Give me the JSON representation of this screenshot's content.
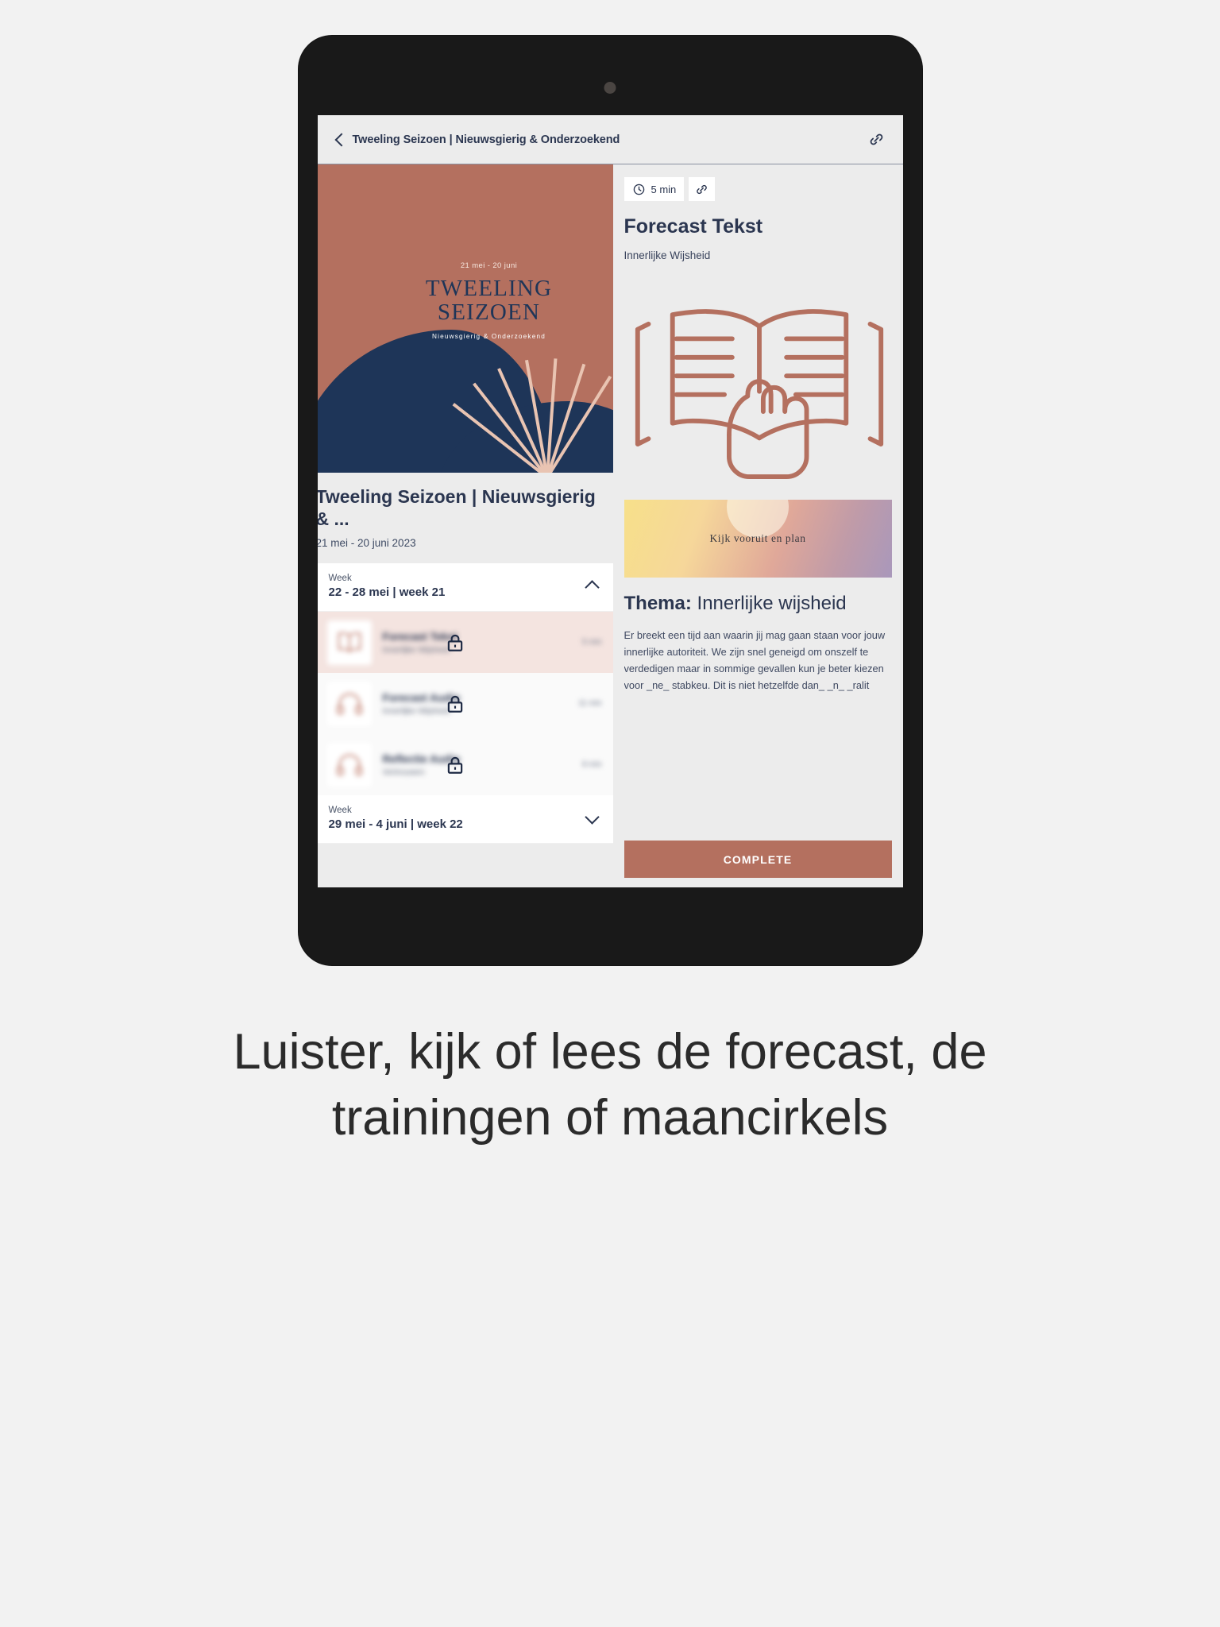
{
  "caption": "Luister, kijk of lees de forecast, de trainingen of maancirkels",
  "app": {
    "header": {
      "title": "Tweeling Seizoen | Nieuwsgierig & Onderzoekend",
      "back_icon": "chevron-left-icon",
      "link_icon": "link-icon"
    }
  },
  "poster": {
    "dates": "21 mei - 20 juni",
    "title_line1": "TWEELING",
    "title_line2": "SEIZOEN",
    "subtitle": "Nieuwsgierig & Onderzoekend"
  },
  "course": {
    "title": "Tweeling Seizoen | Nieuwsgierig & ...",
    "dates": "21 mei - 20 juni 2023"
  },
  "weeks": [
    {
      "label": "Week",
      "range": "22 - 28 mei | week 21",
      "expanded": true,
      "chevron": "chevron-up-icon",
      "lessons": [
        {
          "name": "Forecast Tekst",
          "subtitle": "Innerlijke Wijsheid",
          "duration": "5 min",
          "locked": true,
          "icon": "book-icon",
          "tinted": true
        },
        {
          "name": "Forecast Audio",
          "subtitle": "Innerlijke Wijsheid",
          "duration": "11 min",
          "locked": true,
          "icon": "headphones-icon",
          "tinted": false
        },
        {
          "name": "Reflectie Audio",
          "subtitle": "Vertrouwen",
          "duration": "8 min",
          "locked": true,
          "icon": "headphones-icon",
          "tinted": false
        }
      ]
    },
    {
      "label": "Week",
      "range": "29 mei - 4 juni | week 22",
      "expanded": false,
      "chevron": "chevron-down-icon",
      "lessons": []
    }
  ],
  "lesson_detail": {
    "duration_badge": "5 min",
    "clock_icon": "clock-icon",
    "link_icon": "link-icon",
    "title": "Forecast Tekst",
    "subtitle": "Innerlijke Wijsheid",
    "hero_icon": "open-book-hand-icon",
    "banner_text": "Kijk vooruit en plan",
    "banner_icon": "moon-icon",
    "thema_label": "Thema:",
    "thema_value": "Innerlijke wijsheid",
    "body": "Er breekt een tijd aan waarin jij mag gaan staan voor jouw innerlijke autoriteit. We zijn snel geneigd om onszelf te verdedigen maar in sommige gevallen kun je beter kiezen voor _ne_ stabkeu. Dit is niet hetzelfde dan_ _n_ _ralit",
    "complete_label": "COMPLETE"
  },
  "colors": {
    "brand": "#b4705f",
    "navy": "#2b3650",
    "poster_peach": "#e9c4b2",
    "poster_navy": "#1e3558",
    "screen_bg": "#ececec"
  }
}
